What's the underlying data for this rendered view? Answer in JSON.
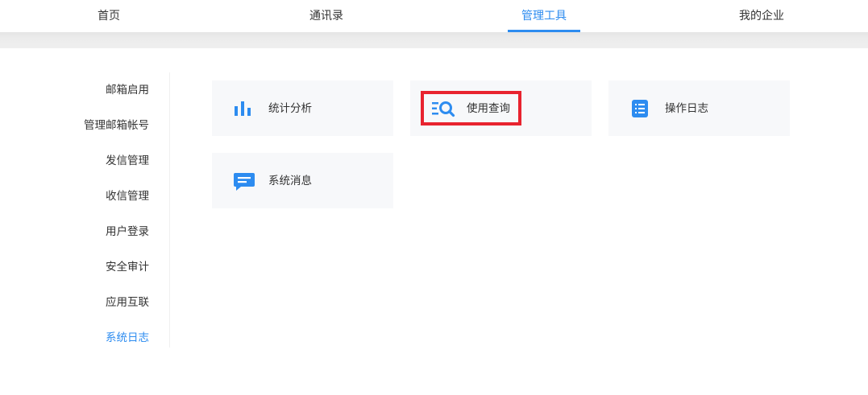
{
  "top_nav": {
    "tabs": [
      {
        "label": "首页"
      },
      {
        "label": "通讯录"
      },
      {
        "label": "管理工具",
        "active": true
      },
      {
        "label": "我的企业"
      }
    ]
  },
  "side_nav": {
    "items": [
      {
        "label": "邮箱启用"
      },
      {
        "label": "管理邮箱帐号"
      },
      {
        "label": "发信管理"
      },
      {
        "label": "收信管理"
      },
      {
        "label": "用户登录"
      },
      {
        "label": "安全审计"
      },
      {
        "label": "应用互联"
      },
      {
        "label": "系统日志",
        "active": true
      }
    ]
  },
  "cards": [
    {
      "label": "统计分析",
      "icon": "bar-chart-icon"
    },
    {
      "label": "使用查询",
      "icon": "list-search-icon",
      "highlighted": true
    },
    {
      "label": "操作日志",
      "icon": "document-list-icon"
    },
    {
      "label": "系统消息",
      "icon": "message-icon"
    }
  ],
  "colors": {
    "accent": "#2d8cf0",
    "highlight_border": "#e8232f",
    "card_bg": "#f7f8fa"
  }
}
